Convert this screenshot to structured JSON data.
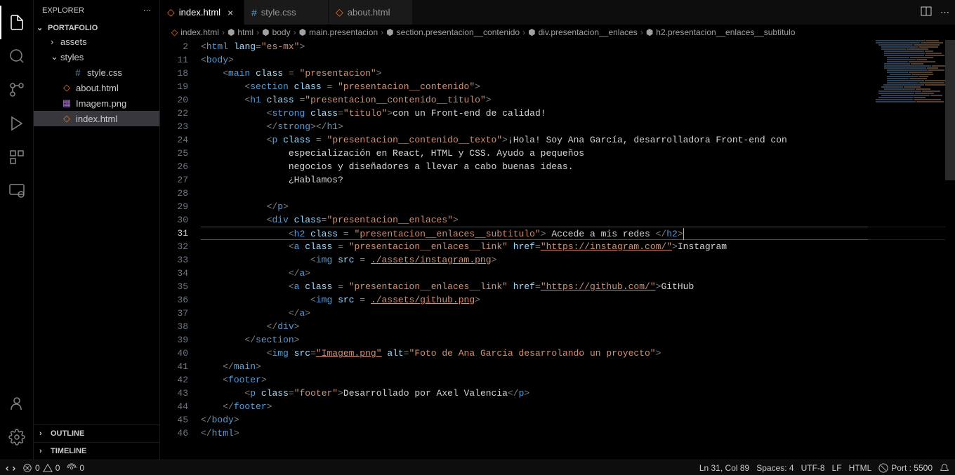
{
  "sidebar": {
    "title": "EXPLORER",
    "project": "PORTAFOLIO",
    "items": [
      {
        "type": "folder",
        "name": "assets",
        "expanded": false,
        "indent": 1
      },
      {
        "type": "folder",
        "name": "styles",
        "expanded": true,
        "indent": 1
      },
      {
        "type": "file",
        "name": "style.css",
        "icon": "css",
        "indent": 2
      },
      {
        "type": "file",
        "name": "about.html",
        "icon": "html",
        "indent": 1
      },
      {
        "type": "file",
        "name": "Imagem.png",
        "icon": "img",
        "indent": 1
      },
      {
        "type": "file",
        "name": "index.html",
        "icon": "html",
        "indent": 1,
        "selected": true
      }
    ],
    "outline": "OUTLINE",
    "timeline": "TIMELINE"
  },
  "tabs": [
    {
      "label": "index.html",
      "icon": "html",
      "active": true,
      "close": true
    },
    {
      "label": "style.css",
      "icon": "css",
      "active": false,
      "close": false
    },
    {
      "label": "about.html",
      "icon": "html",
      "active": false,
      "close": false
    }
  ],
  "breadcrumbs": [
    {
      "icon": "html",
      "label": "index.html"
    },
    {
      "icon": "tag",
      "label": "html"
    },
    {
      "icon": "tag",
      "label": "body"
    },
    {
      "icon": "tag",
      "label": "main.presentacion"
    },
    {
      "icon": "tag",
      "label": "section.presentacion__contenido"
    },
    {
      "icon": "tag",
      "label": "div.presentacion__enlaces"
    },
    {
      "icon": "tag",
      "label": "h2.presentacion__enlaces__subtitulo"
    }
  ],
  "code": {
    "lines": [
      {
        "n": 2,
        "html": "<span class='punct'>&lt;</span><span class='tag'>html</span> <span class='attr'>lang</span><span class='punct'>=</span><span class='str'>\"es-mx\"</span><span class='punct'>&gt;</span>",
        "indent": 0
      },
      {
        "n": 11,
        "html": "<span class='punct'>&lt;</span><span class='tag'>body</span><span class='punct'>&gt;</span>",
        "indent": 0
      },
      {
        "n": 18,
        "html": "<span class='punct'>&lt;</span><span class='tag'>main</span> <span class='attr'>class</span> <span class='punct'>=</span> <span class='str'>\"presentacion\"</span><span class='punct'>&gt;</span>",
        "indent": 1
      },
      {
        "n": 19,
        "html": "<span class='punct'>&lt;</span><span class='tag'>section</span> <span class='attr'>class</span> <span class='punct'>=</span> <span class='str'>\"presentacion__contenido\"</span><span class='punct'>&gt;</span>",
        "indent": 2
      },
      {
        "n": 20,
        "html": "<span class='punct'>&lt;</span><span class='tag'>h1</span> <span class='attr'>class</span> <span class='punct'>=</span><span class='str'>\"presentacion__contenido__titulo\"</span><span class='punct'>&gt;</span>",
        "indent": 2
      },
      {
        "n": 22,
        "html": "<span class='punct'>&lt;</span><span class='tag'>strong</span> <span class='attr'>class</span><span class='punct'>=</span><span class='str'>\"titulo\"</span><span class='punct'>&gt;</span><span class='txt'>con un Front-end de calidad!</span>",
        "indent": 3
      },
      {
        "n": 23,
        "html": "<span class='punct'>&lt;/</span><span class='tag'>strong</span><span class='punct'>&gt;&lt;/</span><span class='tag'>h1</span><span class='punct'>&gt;</span>",
        "indent": 3
      },
      {
        "n": 24,
        "html": "<span class='punct'>&lt;</span><span class='tag'>p</span> <span class='attr'>class</span> <span class='punct'>=</span> <span class='str'>\"presentacion__contenido__texto\"</span><span class='punct'>&gt;</span><span class='txt'>¡Hola! Soy Ana García, desarrolladora Front-end con</span>",
        "indent": 3
      },
      {
        "n": 25,
        "html": "<span class='txt'>especialización en React, HTML y CSS. Ayudo a pequeños</span>",
        "indent": 4
      },
      {
        "n": 26,
        "html": "<span class='txt'>negocios y diseñadores a llevar a cabo buenas ideas.</span>",
        "indent": 4
      },
      {
        "n": 27,
        "html": "<span class='txt'>¿Hablamos?</span>",
        "indent": 4
      },
      {
        "n": 28,
        "html": "",
        "indent": 3
      },
      {
        "n": 29,
        "html": "<span class='punct'>&lt;/</span><span class='tag'>p</span><span class='punct'>&gt;</span>",
        "indent": 3
      },
      {
        "n": 30,
        "html": "<span class='punct'>&lt;</span><span class='tag'>div</span> <span class='attr'>class</span><span class='punct'>=</span><span class='str'>\"presentacion__enlaces\"</span><span class='punct'>&gt;</span>",
        "indent": 3
      },
      {
        "n": 31,
        "html": "<span class='punct'>&lt;</span><span class='tag'>h2</span> <span class='attr'>class</span> <span class='punct'>=</span> <span class='str'>\"presentacion__enlaces__subtitulo\"</span><span class='punct'>&gt;</span><span class='txt'> Accede a mis redes </span><span class='punct'>&lt;/</span><span class='tag'>h2</span><span class='punct'>&gt;</span><span class='cursor'></span>",
        "indent": 4,
        "hl": true
      },
      {
        "n": 32,
        "html": "<span class='punct'>&lt;</span><span class='tag'>a</span> <span class='attr'>class</span> <span class='punct'>=</span> <span class='str'>\"presentacion__enlaces__link\"</span> <span class='attr'>href</span><span class='punct'>=</span><span class='str underline'>\"https://instagram.com/\"</span><span class='punct'>&gt;</span><span class='txt'>Instagram</span>",
        "indent": 4
      },
      {
        "n": 33,
        "html": "<span class='punct'>&lt;</span><span class='tag'>img</span> <span class='attr'>src</span> <span class='punct'>=</span> <span class='str underline'>./assets/instagram.png</span><span class='punct'>&gt;</span>",
        "indent": 5
      },
      {
        "n": 34,
        "html": "<span class='punct'>&lt;/</span><span class='tag'>a</span><span class='punct'>&gt;</span>",
        "indent": 4
      },
      {
        "n": 35,
        "html": "<span class='punct'>&lt;</span><span class='tag'>a</span> <span class='attr'>class</span> <span class='punct'>=</span> <span class='str'>\"presentacion__enlaces__link\"</span> <span class='attr'>href</span><span class='punct'>=</span><span class='str underline'>\"https://github.com/\"</span><span class='punct'>&gt;</span><span class='txt'>GitHub</span>",
        "indent": 4
      },
      {
        "n": 36,
        "html": "<span class='punct'>&lt;</span><span class='tag'>img</span> <span class='attr'>src</span> <span class='punct'>=</span> <span class='str underline'>./assets/github.png</span><span class='punct'>&gt;</span>",
        "indent": 5
      },
      {
        "n": 37,
        "html": "<span class='punct'>&lt;/</span><span class='tag'>a</span><span class='punct'>&gt;</span>",
        "indent": 4
      },
      {
        "n": 38,
        "html": "<span class='punct'>&lt;/</span><span class='tag'>div</span><span class='punct'>&gt;</span>",
        "indent": 3
      },
      {
        "n": 39,
        "html": "<span class='punct'>&lt;/</span><span class='tag'>section</span><span class='punct'>&gt;</span>",
        "indent": 2
      },
      {
        "n": 40,
        "html": "<span class='punct'>&lt;</span><span class='tag'>img</span> <span class='attr'>src</span><span class='punct'>=</span><span class='str underline'>\"Imagem.png\"</span> <span class='attr'>alt</span><span class='punct'>=</span><span class='str'>\"Foto de Ana García desarrolando un proyecto\"</span><span class='punct'>&gt;</span>",
        "indent": 3
      },
      {
        "n": 41,
        "html": "<span class='punct'>&lt;/</span><span class='tag'>main</span><span class='punct'>&gt;</span>",
        "indent": 1
      },
      {
        "n": 42,
        "html": "<span class='punct'>&lt;</span><span class='tag'>footer</span><span class='punct'>&gt;</span>",
        "indent": 1
      },
      {
        "n": 43,
        "html": "<span class='punct'>&lt;</span><span class='tag'>p</span> <span class='attr'>class</span><span class='punct'>=</span><span class='str'>\"footer\"</span><span class='punct'>&gt;</span><span class='txt'>Desarrollado por Axel Valencia</span><span class='punct'>&lt;/</span><span class='tag'>p</span><span class='punct'>&gt;</span>",
        "indent": 2
      },
      {
        "n": 44,
        "html": "<span class='punct'>&lt;/</span><span class='tag'>footer</span><span class='punct'>&gt;</span>",
        "indent": 1
      },
      {
        "n": 45,
        "html": "<span class='punct'>&lt;/</span><span class='tag'>body</span><span class='punct'>&gt;</span>",
        "indent": 0
      },
      {
        "n": 46,
        "html": "<span class='punct'>&lt;/</span><span class='tag'>html</span><span class='punct'>&gt;</span>",
        "indent": 0
      }
    ]
  },
  "statusbar": {
    "errors": "0",
    "warnings": "0",
    "port_status": "0",
    "cursor": "Ln 31, Col 89",
    "spaces": "Spaces: 4",
    "encoding": "UTF-8",
    "eol": "LF",
    "lang": "HTML",
    "port": "Port : 5500"
  }
}
